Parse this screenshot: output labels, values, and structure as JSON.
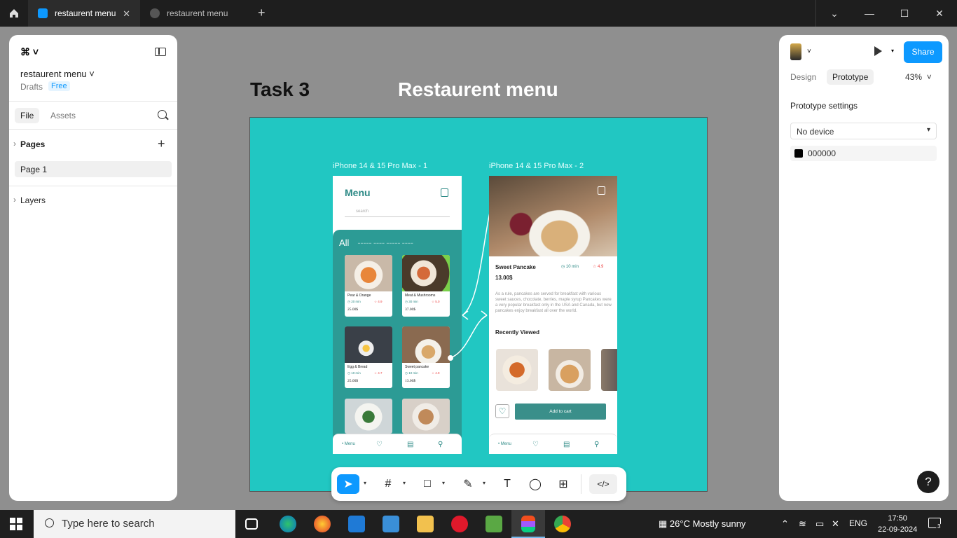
{
  "tabs": [
    {
      "label": "restaurent menu",
      "active": true
    },
    {
      "label": "restaurent menu",
      "active": false
    }
  ],
  "left_panel": {
    "file_name": "restaurent menu",
    "location": "Drafts",
    "plan": "Free",
    "tab_file": "File",
    "tab_assets": "Assets",
    "pages_label": "Pages",
    "page_item": "Page 1",
    "layers_label": "Layers"
  },
  "canvas": {
    "heading_task": "Task 3",
    "heading_title": "Restaurent menu",
    "phone1_label": "iPhone 14 & 15 Pro Max - 1",
    "phone2_label": "iPhone 14 & 15 Pro Max - 2",
    "frame_color": "#21c7c2"
  },
  "phone1": {
    "title": "Menu",
    "search_placeholder": "search",
    "category": "All",
    "cards": [
      {
        "name": "Pear & Orange",
        "time": "20 min",
        "rating": "4.9",
        "price": "25.00$"
      },
      {
        "name": "Meat & Mushrooms",
        "time": "30 min",
        "rating": "5.0",
        "price": "37.00$"
      },
      {
        "name": "Egg & Bread",
        "time": "10 min",
        "rating": "4.7",
        "price": "25.00$"
      },
      {
        "name": "Sweet pancake",
        "time": "10 min",
        "rating": "4.9",
        "price": "13.00$"
      }
    ],
    "nav_label": "• Menu"
  },
  "phone2": {
    "title": "Sweet Pancake",
    "time": "10 min",
    "rating": "4.9",
    "price": "13.00$",
    "description": "As a rule, pancakes are served for breakfast with various sweet sauces, chocolate, berries, maple syrup Pancakes were a very popular breakfast only in the USA and Canada, but now pancakes enjoy breakfast all over the world.",
    "recent_label": "Recently Viewed",
    "cart_button": "Add to cart",
    "nav_label": "• Menu"
  },
  "right_panel": {
    "share": "Share",
    "tab_design": "Design",
    "tab_prototype": "Prototype",
    "zoom": "43%",
    "settings_title": "Prototype settings",
    "device": "No device",
    "bg_color": "000000"
  },
  "taskbar": {
    "search_placeholder": "Type here to search",
    "weather": "26°C  Mostly sunny",
    "language": "ENG",
    "time": "17:50",
    "date": "22-09-2024",
    "notifications": "3"
  }
}
